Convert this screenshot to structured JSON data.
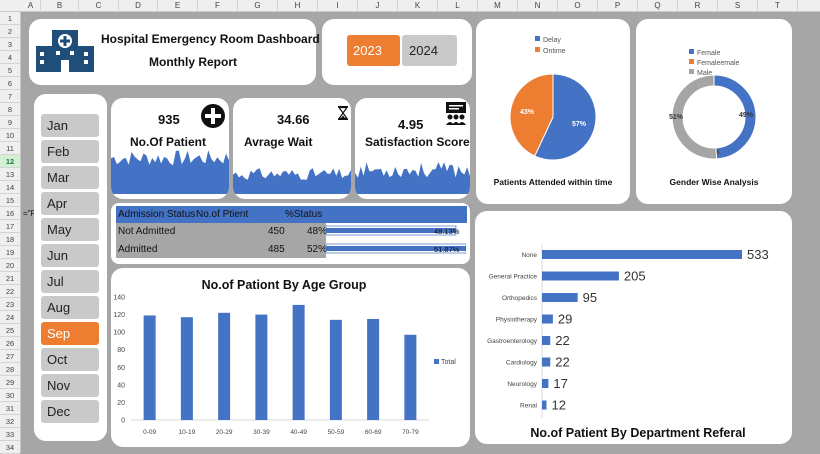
{
  "spreadsheet": {
    "columns": [
      "A",
      "B",
      "C",
      "D",
      "E",
      "F",
      "G",
      "H",
      "I",
      "J",
      "K",
      "L",
      "M",
      "N",
      "O",
      "P",
      "Q",
      "R",
      "S",
      "T"
    ],
    "rows": [
      "1",
      "2",
      "3",
      "4",
      "5",
      "6",
      "7",
      "8",
      "9",
      "10",
      "11",
      "12",
      "13",
      "14",
      "15",
      "16",
      "17",
      "18",
      "19",
      "20",
      "21",
      "22",
      "23",
      "24",
      "25",
      "26",
      "27",
      "28",
      "29",
      "30",
      "31",
      "32",
      "33",
      "34"
    ],
    "selected_row": "12",
    "cell_fragment": "=\"F"
  },
  "header": {
    "title": "Hospital Emergency Room Dashboard",
    "subtitle": "Monthly Report"
  },
  "years": [
    {
      "label": "2023",
      "active": true
    },
    {
      "label": "2024",
      "active": false
    }
  ],
  "months": [
    {
      "label": "Jan",
      "active": false
    },
    {
      "label": "Feb",
      "active": false
    },
    {
      "label": "Mar",
      "active": false
    },
    {
      "label": "Apr",
      "active": false
    },
    {
      "label": "May",
      "active": false
    },
    {
      "label": "Jun",
      "active": false
    },
    {
      "label": "Jul",
      "active": false
    },
    {
      "label": "Aug",
      "active": false
    },
    {
      "label": "Sep",
      "active": true
    },
    {
      "label": "Oct",
      "active": false
    },
    {
      "label": "Nov",
      "active": false
    },
    {
      "label": "Dec",
      "active": false
    }
  ],
  "kpis": {
    "patients": {
      "value": "935",
      "label": "No.Of Patient"
    },
    "wait": {
      "value": "34.66",
      "label": "Avrage Wait"
    },
    "satisfaction": {
      "value": "4.95",
      "label": "Satisfaction Score"
    }
  },
  "admission_table": {
    "headers": [
      "Admission Status",
      "No.of Ptient",
      "%Status"
    ],
    "rows": [
      {
        "status": "Not Admitted",
        "count": "450",
        "pct": "48%",
        "bar_label": "48.13%",
        "bar_value": 48.13
      },
      {
        "status": "Admitted",
        "count": "485",
        "pct": "52%",
        "bar_label": "51.87%",
        "bar_value": 51.87
      }
    ]
  },
  "colors": {
    "blue": "#4472c4",
    "orange": "#ed7d31",
    "grey": "#a5a5a5"
  },
  "chart_data": [
    {
      "type": "pie",
      "title": "Patients Attended within time",
      "categories": [
        "Delay",
        "Ontime"
      ],
      "values": [
        57,
        43
      ],
      "labels": [
        "57%",
        "43%"
      ],
      "legend": "top-center"
    },
    {
      "type": "pie",
      "title": "Gender Wise Analysis",
      "categories": [
        "Female",
        "Femaleemale",
        "Male"
      ],
      "values": [
        49,
        0,
        51
      ],
      "labels": [
        "49%",
        "0%",
        "51%"
      ],
      "legend": "top-left"
    },
    {
      "type": "bar",
      "title": "No.of Pationt By Age Group",
      "categories": [
        "0-09",
        "10-19",
        "20-29",
        "30-39",
        "40-49",
        "50-59",
        "60-69",
        "70-79"
      ],
      "series": [
        {
          "name": "Total",
          "values": [
            119,
            117,
            122,
            120,
            131,
            114,
            115,
            97
          ]
        }
      ],
      "ylim": [
        0,
        140
      ],
      "yticks": [
        0,
        20,
        40,
        60,
        80,
        100,
        120,
        140
      ],
      "legend": "right"
    },
    {
      "type": "bar",
      "orientation": "horizontal",
      "title": "No.of Patient By Department Referal",
      "categories": [
        "None",
        "General Practice",
        "Orthopedics",
        "Physiotherapy",
        "Gastroenterology",
        "Cardiology",
        "Neurology",
        "Renal"
      ],
      "values": [
        533,
        205,
        95,
        29,
        22,
        22,
        17,
        12
      ],
      "labels": [
        "533",
        "205",
        "95",
        "29",
        "22",
        "22",
        "17",
        "12"
      ]
    }
  ]
}
